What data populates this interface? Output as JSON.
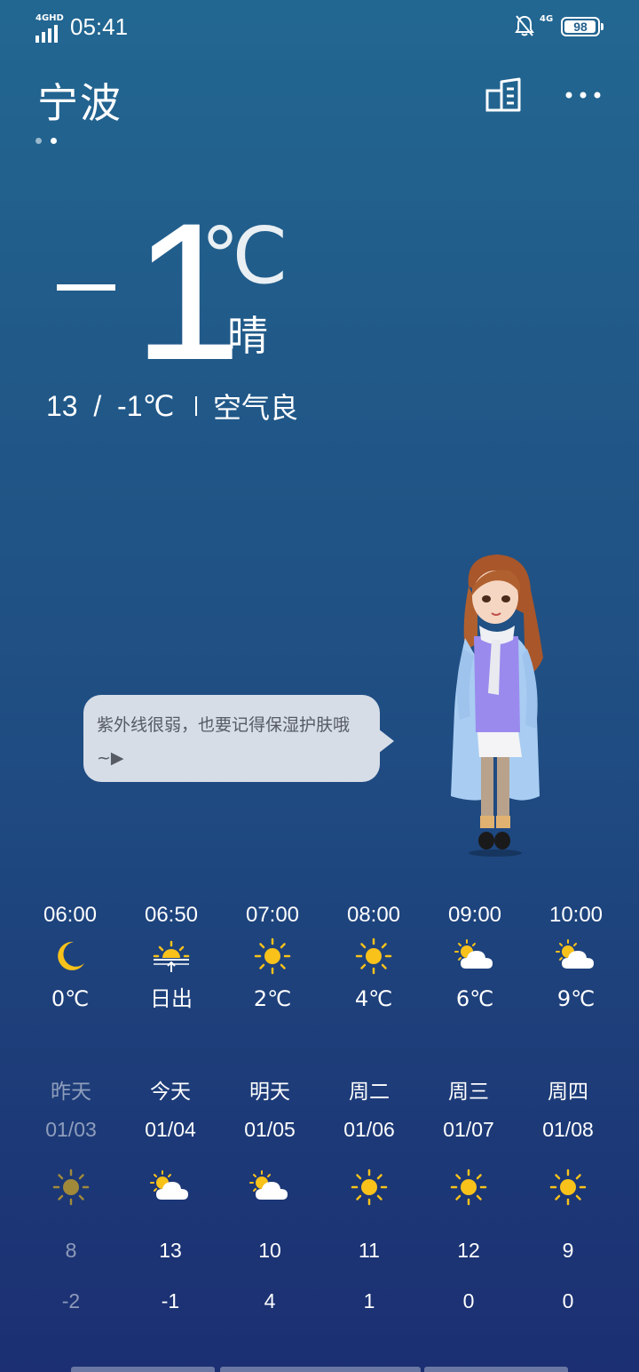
{
  "status_bar": {
    "signal_label": "4GHD",
    "time": "05:41",
    "network": "4G",
    "battery": "98",
    "icons": [
      "signal-icon",
      "bell-mute-icon",
      "battery-icon"
    ]
  },
  "header": {
    "city": "宁波",
    "icons": [
      "city-manage-icon",
      "more-icon"
    ]
  },
  "current": {
    "minus": "−",
    "temp": "1",
    "unit": "℃",
    "condition": "晴",
    "high": "13",
    "slash": "/",
    "low": "-1℃",
    "air_quality": "空气良"
  },
  "tip": {
    "text": "紫外线很弱，也要记得保湿护肤哦~▶"
  },
  "hourly": [
    {
      "time": "06:00",
      "icon": "moon-icon",
      "value": "0℃"
    },
    {
      "time": "06:50",
      "icon": "sunrise-icon",
      "value": "日出"
    },
    {
      "time": "07:00",
      "icon": "sun-icon",
      "value": "2℃"
    },
    {
      "time": "08:00",
      "icon": "sun-icon",
      "value": "4℃"
    },
    {
      "time": "09:00",
      "icon": "partly-cloudy-icon",
      "value": "6℃"
    },
    {
      "time": "10:00",
      "icon": "partly-cloudy-icon",
      "value": "9℃"
    }
  ],
  "daily": [
    {
      "day": "昨天",
      "date": "01/03",
      "icon": "sun-icon",
      "high": "8",
      "low": "-2"
    },
    {
      "day": "今天",
      "date": "01/04",
      "icon": "partly-cloudy-icon",
      "high": "13",
      "low": "-1"
    },
    {
      "day": "明天",
      "date": "01/05",
      "icon": "partly-cloudy-icon",
      "high": "10",
      "low": "4"
    },
    {
      "day": "周二",
      "date": "01/06",
      "icon": "sun-icon",
      "high": "11",
      "low": "1"
    },
    {
      "day": "周三",
      "date": "01/07",
      "icon": "sun-icon",
      "high": "12",
      "low": "0"
    },
    {
      "day": "周四",
      "date": "01/08",
      "icon": "sun-icon",
      "high": "9",
      "low": "0"
    }
  ],
  "colors": {
    "bg_top": "#226792",
    "bg_bottom": "#1b2f72",
    "sun": "#f8c21b",
    "sun_dim": "#a08a3a",
    "bubble": "#d6dde7"
  }
}
